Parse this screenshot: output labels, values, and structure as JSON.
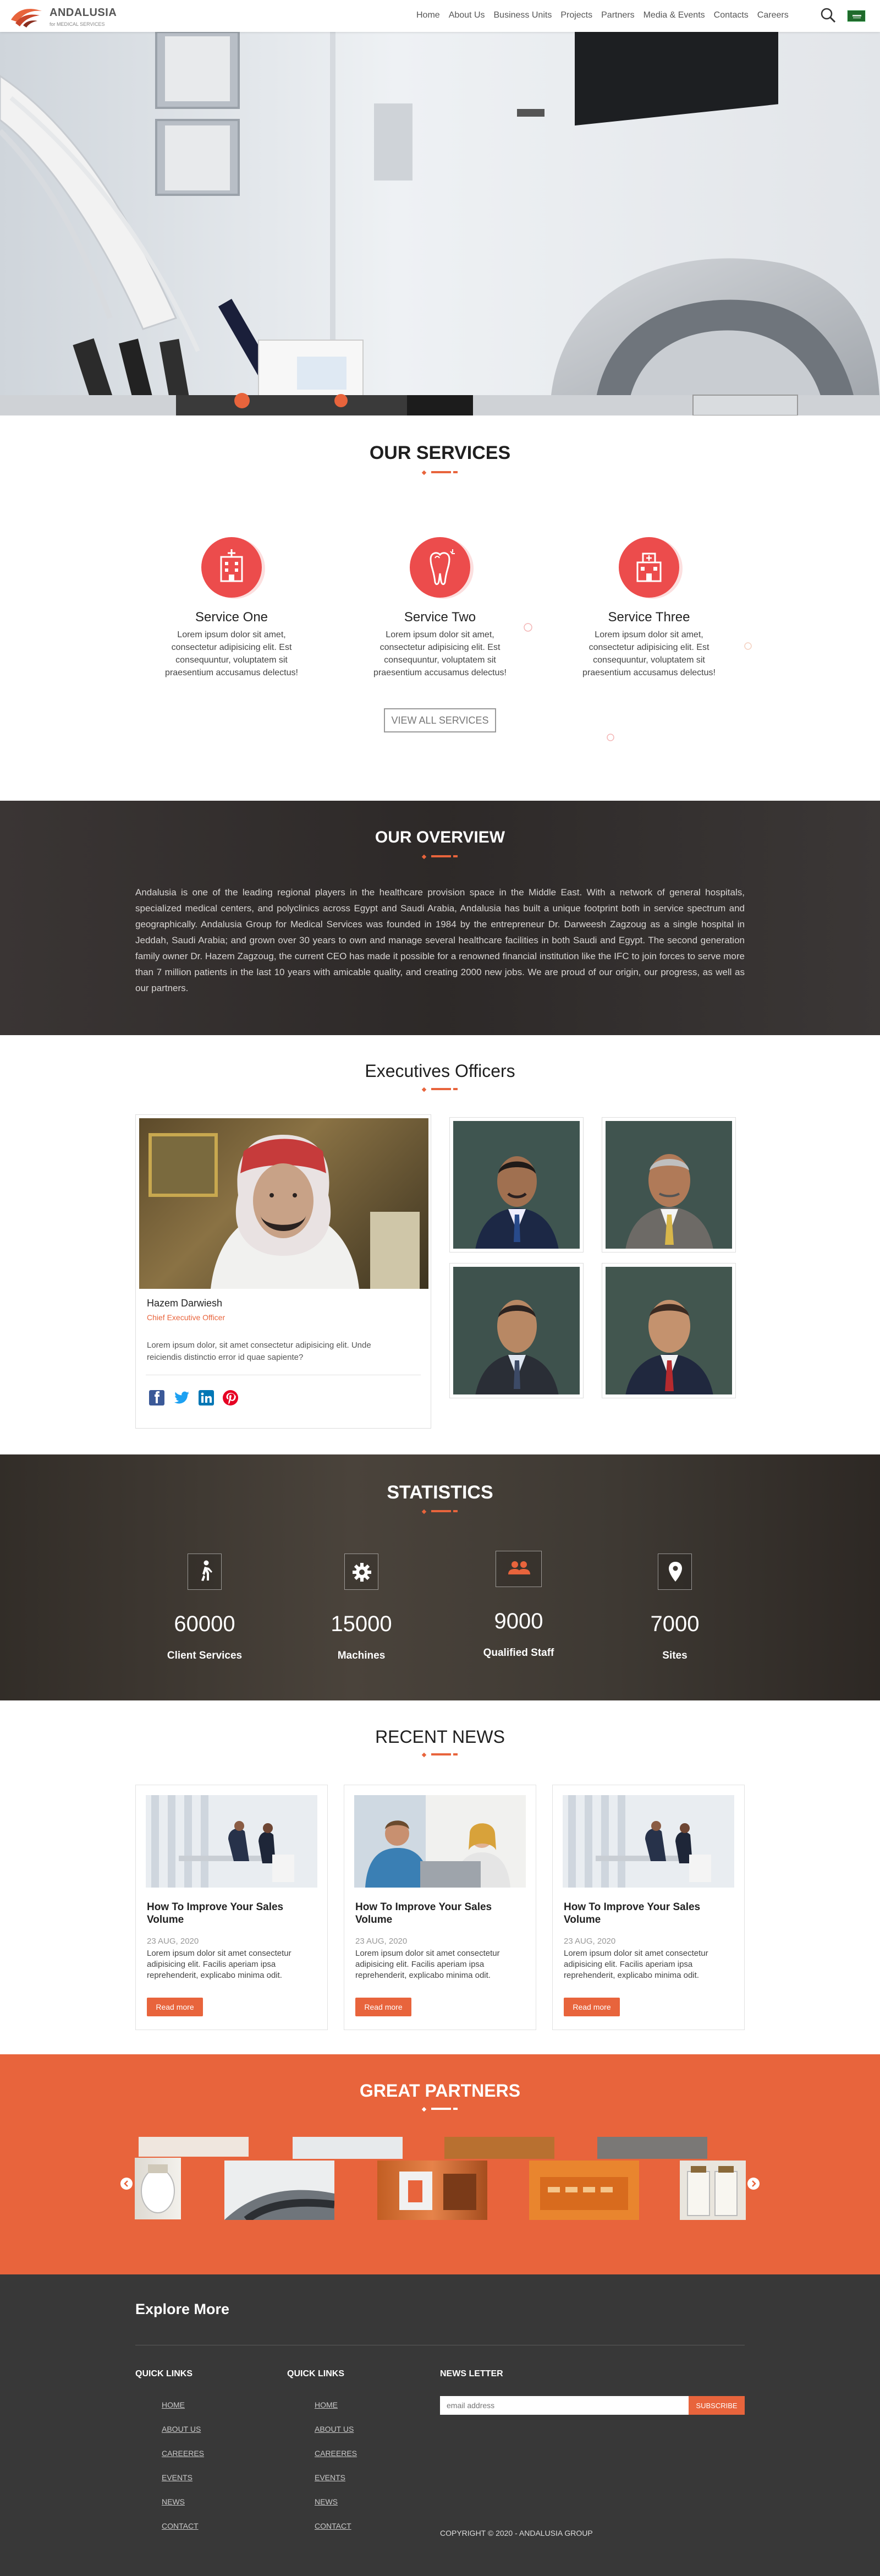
{
  "header": {
    "logo_name": "ANDALUSIA",
    "logo_sub": "for MEDICAL SERVICES",
    "nav": [
      "Home",
      "About Us",
      "Business Units",
      "Projects",
      "Partners",
      "Media & Events",
      "Contacts",
      "Careers"
    ],
    "flag_label": ""
  },
  "services": {
    "title": "OUR SERVICES",
    "items": [
      {
        "title": "Service One",
        "text": "Lorem ipsum dolor sit amet, consectetur adipisicing elit. Est consequuntur, voluptatem sit praesentium accusamus delectus!"
      },
      {
        "title": "Service Two",
        "text": "Lorem ipsum dolor sit amet, consectetur adipisicing elit. Est consequuntur, voluptatem sit praesentium accusamus delectus!"
      },
      {
        "title": "Service Three",
        "text": "Lorem ipsum dolor sit amet, consectetur adipisicing elit. Est consequuntur, voluptatem sit praesentium accusamus delectus!"
      }
    ],
    "view_all": "VIEW ALL SERVICES"
  },
  "overview": {
    "title": "OUR OVERVIEW",
    "text": "Andalusia is one of the leading regional players in the healthcare provision space in the Middle East. With a network of general hospitals, specialized medical centers, and polyclinics across Egypt and Saudi Arabia, Andalusia has built a unique footprint both in service spectrum and geographically. Andalusia Group for Medical Services was founded in 1984 by the entrepreneur Dr. Darweesh Zagzoug as a single hospital in Jeddah, Saudi Arabia; and grown over 30 years to own and manage several healthcare facilities in both Saudi and Egypt. The second generation family owner Dr. Hazem Zagzoug, the current CEO has made it possible for a renowned financial institution like the IFC to join forces to serve more than 7 million patients in the last 10 years with amicable quality, and creating 2000 new jobs. We are proud of our origin, our progress, as well as our partners."
  },
  "executives": {
    "title": "Executives Officers",
    "main": {
      "name": "Hazem Darwiesh",
      "role": "Chief Executive Officer",
      "bio": "Lorem ipsum dolor, sit amet consectetur adipisicing elit. Unde reiciendis distinctio error id quae sapiente?"
    }
  },
  "statistics": {
    "title": "STATISTICS",
    "items": [
      {
        "value": "60000",
        "label": "Client Services",
        "icon": "walking-person-icon"
      },
      {
        "value": "15000",
        "label": "Machines",
        "icon": "gear-icon"
      },
      {
        "value": "9000",
        "label": "Qualified Staff",
        "icon": "users-icon"
      },
      {
        "value": "7000",
        "label": "Sites",
        "icon": "map-marker-icon"
      }
    ]
  },
  "news": {
    "title": "RECENT NEWS",
    "items": [
      {
        "title": "How To Improve Your Sales Volume",
        "date": "23 AUG, 2020",
        "excerpt": "Lorem ipsum dolor sit amet consectetur adipisicing elit. Facilis aperiam ipsa reprehenderit, explicabo minima odit.",
        "button": "Read more"
      },
      {
        "title": "How To Improve Your Sales Volume",
        "date": "23 AUG, 2020",
        "excerpt": "Lorem ipsum dolor sit amet consectetur adipisicing elit. Facilis aperiam ipsa reprehenderit, explicabo minima odit.",
        "button": "Read more"
      },
      {
        "title": "How To Improve Your Sales Volume",
        "date": "23 AUG, 2020",
        "excerpt": "Lorem ipsum dolor sit amet consectetur adipisicing elit. Facilis aperiam ipsa reprehenderit, explicabo minima odit.",
        "button": "Read more"
      }
    ]
  },
  "partners": {
    "title": "GREAT PARTNERS"
  },
  "footer": {
    "title": "Explore More",
    "col1_title": "QUICK LINKS",
    "col2_title": "QUICK LINKS",
    "links": [
      "HOME",
      "ABOUT US",
      "CAREERES",
      "EVENTS",
      "NEWS",
      "CONTACT"
    ],
    "newsletter_title": "NEWS LETTER",
    "email_placeholder": "email address",
    "subscribe": "SUBSCRIBE",
    "copyright": "COPYRIGHT © 2020 - ANDALUSIA GROUP"
  },
  "colors": {
    "accent": "#e8643c",
    "service_icon": "#ec4c4c",
    "dark": "#383838"
  }
}
